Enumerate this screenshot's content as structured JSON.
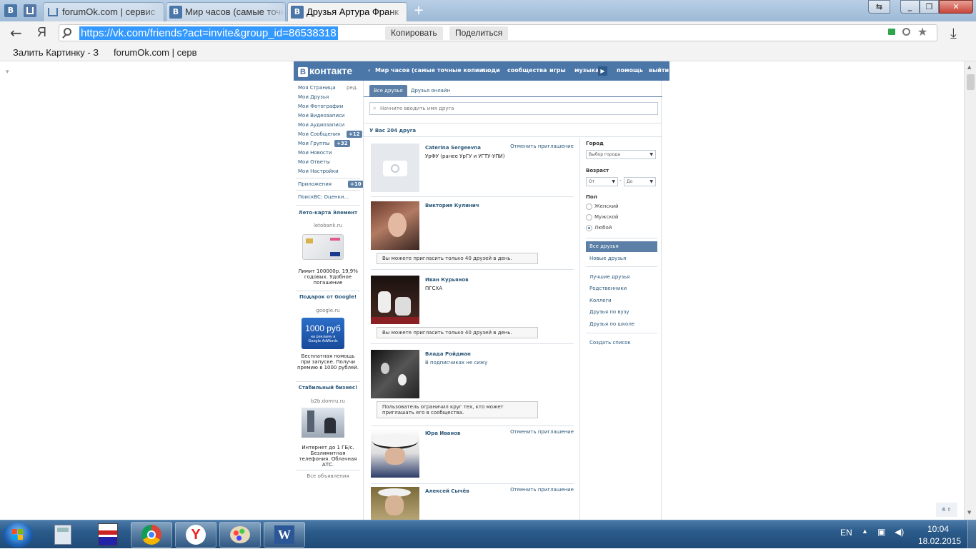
{
  "browser": {
    "tabs": [
      {
        "label": "forumOk.com | сервис"
      },
      {
        "label": "Мир часов (самые точные"
      },
      {
        "label": "Друзья Артура Франк"
      }
    ],
    "address": {
      "url": "https://vk.com/friends?act=invite&group_id=86538318",
      "copy_label": "Копировать",
      "share_label": "Поделиться",
      "ya_label": "Я"
    },
    "bookmarks": [
      {
        "label": "Залить Картинку - З"
      },
      {
        "label": "forumOk.com | серв"
      }
    ]
  },
  "vk": {
    "logo_text": "контакте",
    "logo_letter": "В",
    "nav": {
      "group": "Мир часов (самые точные копии...",
      "people": "люди",
      "communities": "сообщества",
      "games": "игры",
      "music": "музыка",
      "help": "помощь",
      "logout": "выйти"
    },
    "left_menu": {
      "my_page": "Моя Страница",
      "edit": "ред.",
      "friends": "Мои Друзья",
      "photos": "Мои Фотографии",
      "videos": "Мои Видеозаписи",
      "audio": "Мои Аудиозаписи",
      "messages": "Мои Сообщения",
      "messages_badge": "+12",
      "groups": "Мои Группы",
      "groups_badge": "+32",
      "news": "Мои Новости",
      "answers": "Мои Ответы",
      "settings": "Мои Настройки",
      "apps": "Приложения",
      "apps_badge": "+10",
      "app_item": "ПоискВС: Оценки..."
    },
    "ads": [
      {
        "title": "Лето-карта Элемент",
        "domain": "letobank.ru",
        "text": "Лимит 100000р. 19,9% годовых. Удобное погашение"
      },
      {
        "title": "Подарок от Google!",
        "domain": "google.ru",
        "banner_big": "1000 руб",
        "banner_small": "на рекламу в Google AdWords",
        "text": "Бесплатная помощь при запуске. Получи премию в 1000 рублей."
      },
      {
        "title": "Стабильный бизнес!",
        "domain": "b2b.domru.ru",
        "text": "Интернет до 1 ГБ/с. Безлимитная телефония. Облачная АТС."
      }
    ],
    "all_ads": "Все объявления",
    "tabs": {
      "all": "Все друзья",
      "online": "Друзья онлайн"
    },
    "search_placeholder": "Начните вводить имя друга",
    "friends_count": "У Вас 204 друга",
    "friends": [
      {
        "name": "Caterina Sergeevna",
        "info": "УрФУ (ранее УрГУ и УГТУ-УПИ)",
        "action": "Отменить приглашение"
      },
      {
        "name": "Виктория Кулинич",
        "note": "Вы можете пригласить только 40 друзей в день."
      },
      {
        "name": "Иван Курьянов",
        "info": "ПГСХА",
        "note": "Вы можете пригласить только 40 друзей в день."
      },
      {
        "name": "Влада Ройдман",
        "info": "В подписчиках не сижу",
        "note": "Пользователь ограничил круг тех, кто может приглашать его в сообщества."
      },
      {
        "name": "Юра Иванов",
        "action": "Отменить приглашение"
      },
      {
        "name": "Алексей Сычёв",
        "action": "Отменить приглашение"
      }
    ],
    "filters": {
      "city_label": "Город",
      "city_select": "Выбор города",
      "age_label": "Возраст",
      "age_from": "От",
      "age_dash": "-",
      "age_to": "До",
      "sex_label": "Пол",
      "female": "Женский",
      "male": "Мужской",
      "any": "Любой",
      "any_selected": true,
      "menu_all": "Все друзья",
      "menu_new": "Новые друзья",
      "menu_best": "Лучшие друзья",
      "menu_relatives": "Родственники",
      "menu_colleagues": "Коллеги",
      "menu_uni": "Друзья по вузу",
      "menu_school": "Друзья по школе",
      "menu_create": "Создать список"
    },
    "up_counter": "6 ⇧"
  },
  "taskbar": {
    "lang": "EN",
    "time": "10:04",
    "date": "18.02.2015"
  },
  "colors": {
    "vk_blue": "#4a76a8",
    "vk_link": "#2b587a",
    "vk_active": "#5b7fa6",
    "selection": "#3399ff"
  }
}
